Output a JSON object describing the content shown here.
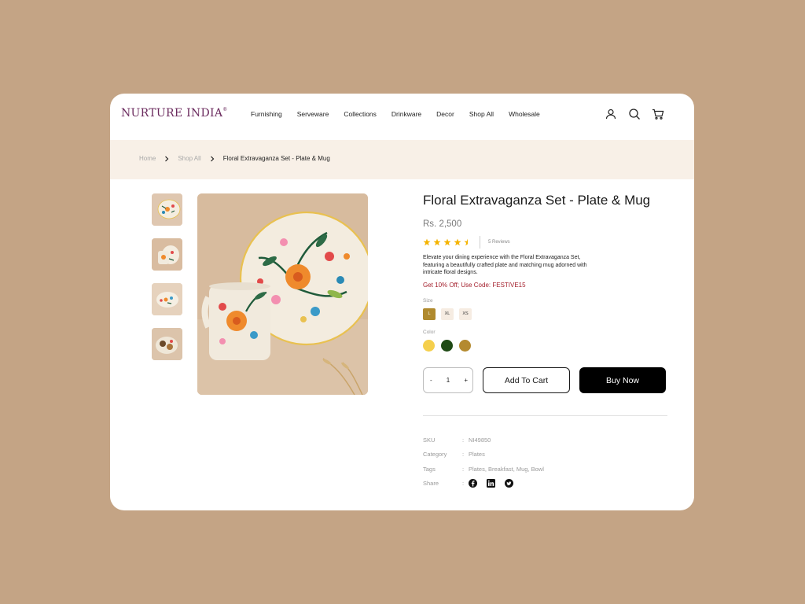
{
  "brand": {
    "name": "NURTURE INDIA",
    "mark": "®"
  },
  "nav": [
    "Furnishing",
    "Serveware",
    "Collections",
    "Drinkware",
    "Decor",
    "Shop All",
    "Wholesale"
  ],
  "header_icons": [
    "user-icon",
    "search-icon",
    "cart-icon"
  ],
  "breadcrumb": {
    "home": "Home",
    "shop_all": "Shop All",
    "current": "Floral Extravaganza Set - Plate & Mug"
  },
  "product": {
    "title": "Floral Extravaganza Set - Plate & Mug",
    "price": "Rs. 2,500",
    "rating": 4.5,
    "reviews": "5 Reviews",
    "description": "Elevate your dining experience with the Floral Extravaganza Set, featuring a beautifully crafted plate and matching mug adorned with intricate floral designs.",
    "promo": "Get 10% Off; Use Code: FESTIVE15",
    "size_label": "Size",
    "sizes": [
      "L",
      "XL",
      "XS"
    ],
    "selected_size": "L",
    "color_label": "Color",
    "colors": [
      "#f5cf4c",
      "#1f4a15",
      "#b48a2f"
    ],
    "quantity": {
      "minus": "-",
      "value": "1",
      "plus": "+"
    },
    "add_to_cart": "Add To Cart",
    "buy_now": "Buy Now"
  },
  "meta": {
    "sku_label": "SKU",
    "sku": "NI49850",
    "category_label": "Category",
    "category": "Plates",
    "tags_label": "Tags",
    "tags": "Plates, Breakfast, Mug, Bowl",
    "share_label": "Share",
    "colon": ":",
    "share_icons": [
      "facebook-icon",
      "linkedin-icon",
      "twitter-icon"
    ]
  },
  "colors": {
    "background": "#c4a485",
    "brand": "#6b2b5e",
    "promo": "#a31e2b",
    "accent": "#b08a2e",
    "crumb_bg": "#f8f0e7"
  }
}
